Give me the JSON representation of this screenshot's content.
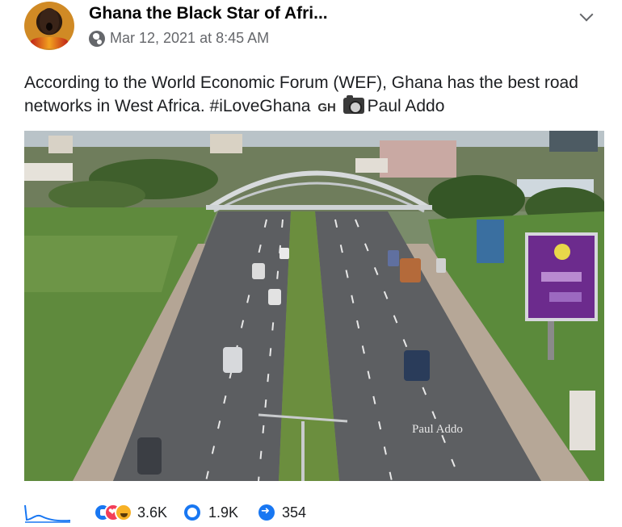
{
  "post": {
    "page_name": "Ghana the Black Star of Afri...",
    "timestamp": "Mar 12, 2021 at 8:45 AM",
    "privacy_icon": "globe-icon",
    "caption_text": "According to the World Economic Forum (WEF), Ghana has the best road networks in West Africa. #iLoveGhana",
    "flag_text": "GH",
    "camera_icon": "camera-icon",
    "photo_credit": "Paul Addo",
    "photo_watermark": "Paul Addo"
  },
  "stats": {
    "reactions_count": "3.6K",
    "comments_count": "1.9K",
    "shares_count": "354",
    "reaction_icons": [
      "like-icon",
      "love-icon",
      "haha-icon"
    ]
  },
  "colors": {
    "accent": "#1877f2",
    "text_primary": "#050505",
    "text_secondary": "#65676b"
  }
}
